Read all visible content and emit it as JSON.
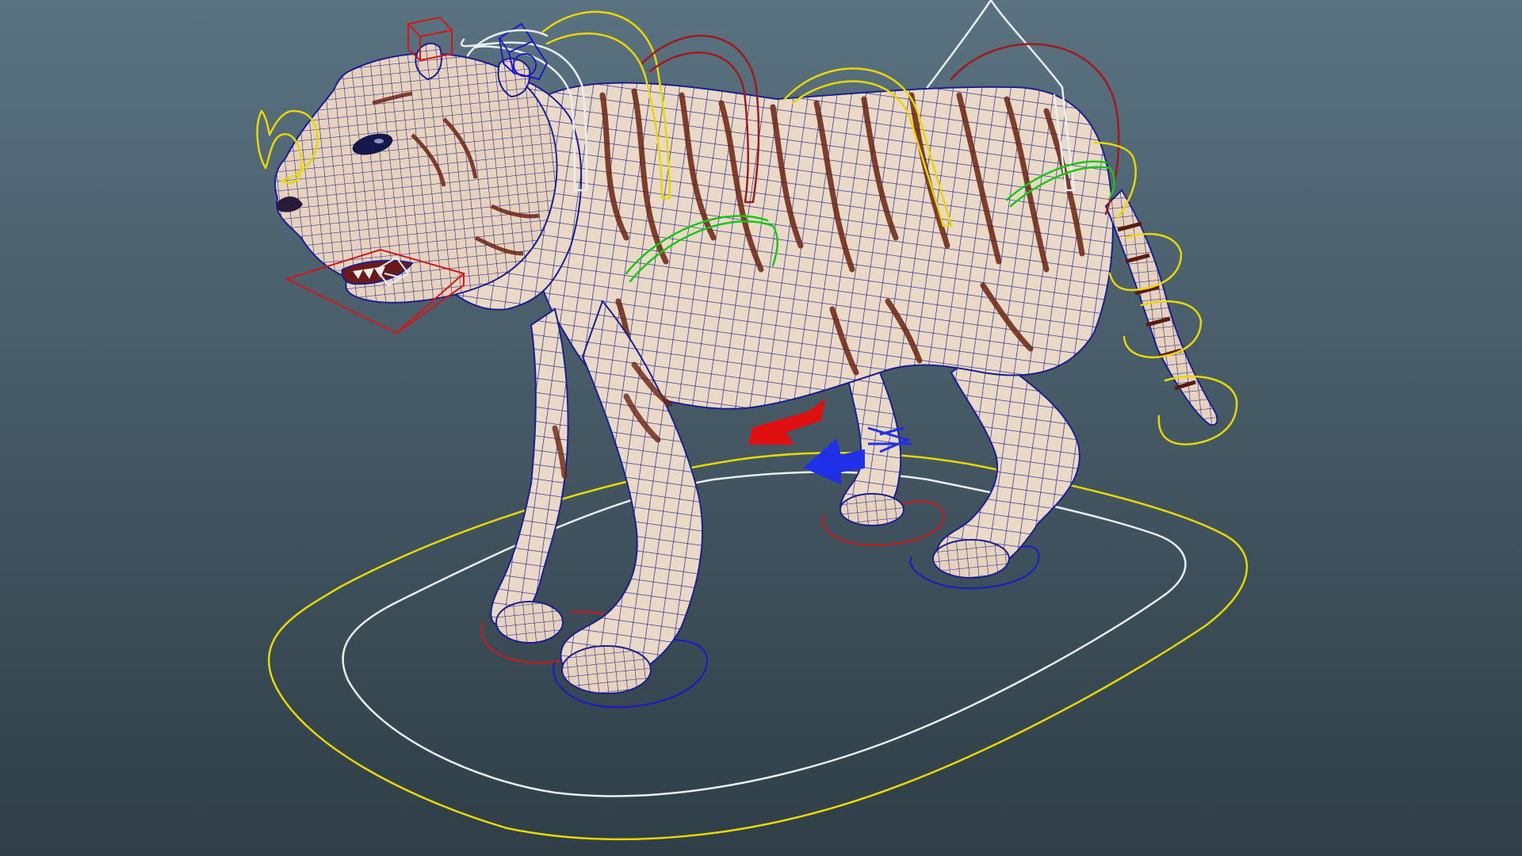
{
  "viewport": {
    "background_top": "#5a7281",
    "background_bottom": "#2f3e47"
  },
  "colors": {
    "main_control": "#e8d800",
    "root_control": "#e8eef2",
    "left_control": "#d01818",
    "right_control": "#1a1acc",
    "spine_control": "#18c818",
    "wireframe": "#161a8a",
    "fur": "#e9d6c2",
    "stripe": "#6a2414",
    "neck_arch": "#a01c1c"
  },
  "scene": {
    "model": "tiger-rig",
    "controls": [
      "main-placement-control",
      "root-control",
      "head-control",
      "jaw-control",
      "eye-aim-control",
      "ear-left-control",
      "ear-right-control",
      "neck-control",
      "spine-fk-controls",
      "hip-control",
      "tail-fk-controls",
      "foot-ik-front-left",
      "foot-ik-front-right",
      "foot-ik-back-left",
      "foot-ik-back-right",
      "pole-vector-arrows"
    ]
  }
}
